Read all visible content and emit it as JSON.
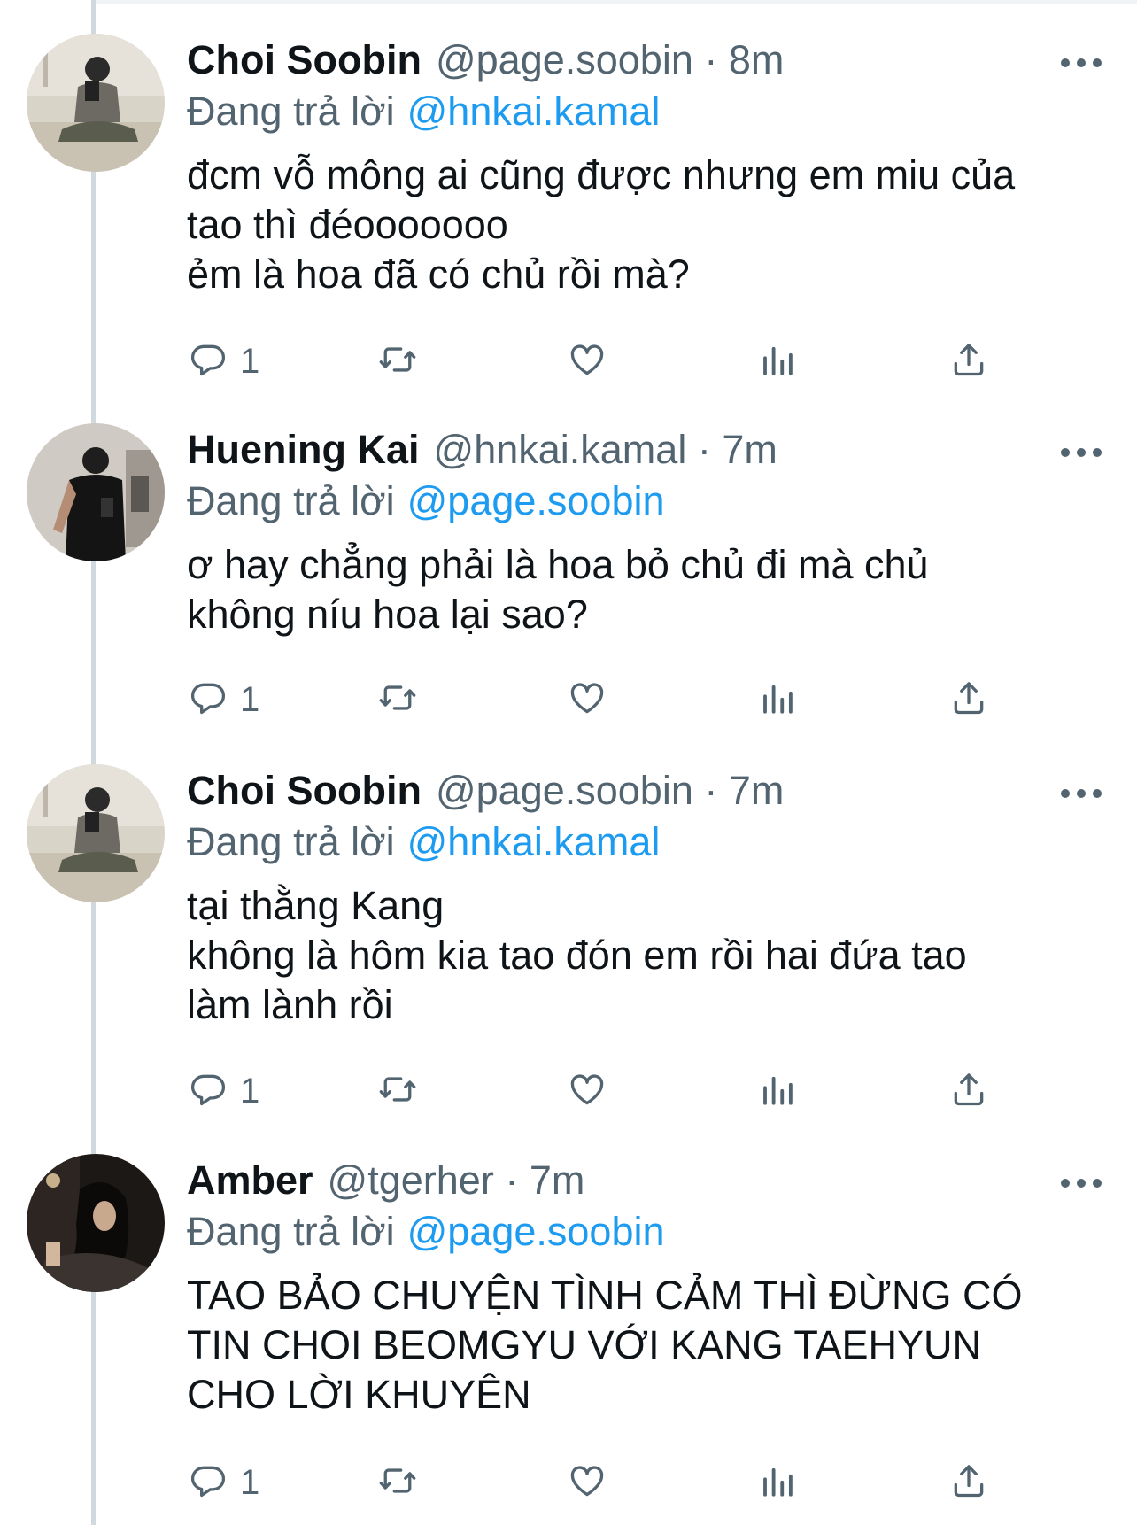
{
  "reply_prefix": "Đang trả lời",
  "colors": {
    "accent": "#1d9bf0",
    "text": "#0f1419",
    "secondary": "#536471",
    "thread_line": "#cfd9de"
  },
  "icons": {
    "more": "more-dots-icon",
    "reply": "reply-bubble-icon",
    "retweet": "retweet-icon",
    "like": "heart-icon",
    "views": "analytics-icon",
    "share": "share-icon"
  },
  "tweets": [
    {
      "name": "Choi Soobin",
      "handle": "@page.soobin",
      "time": "8m",
      "reply_to": "@hnkai.kamal",
      "text_lines": [
        "đcm vỗ mông ai cũng được nhưng em miu của",
        "tao thì đéooooooo",
        "ẻm là hoa đã có chủ rồi mà?"
      ],
      "reply_count": "1"
    },
    {
      "name": "Huening Kai",
      "handle": "@hnkai.kamal",
      "time": "7m",
      "reply_to": "@page.soobin",
      "text_lines": [
        "ơ hay chẳng phải là hoa bỏ chủ đi mà chủ",
        "không níu hoa lại sao?"
      ],
      "reply_count": "1"
    },
    {
      "name": "Choi Soobin",
      "handle": "@page.soobin",
      "time": "7m",
      "reply_to": "@hnkai.kamal",
      "text_lines": [
        "tại thằng Kang",
        "không là hôm kia tao đón em rồi hai đứa tao",
        "làm lành rồi"
      ],
      "reply_count": "1"
    },
    {
      "name": "Amber",
      "handle": "@tgerher",
      "time": "7m",
      "reply_to": "@page.soobin",
      "text_lines": [
        "TAO BẢO CHUYỆN TÌNH CẢM THÌ ĐỪNG CÓ",
        "TIN CHOI BEOMGYU VỚI KANG TAEHYUN",
        "CHO LỜI KHUYÊN"
      ],
      "reply_count": "1"
    }
  ]
}
